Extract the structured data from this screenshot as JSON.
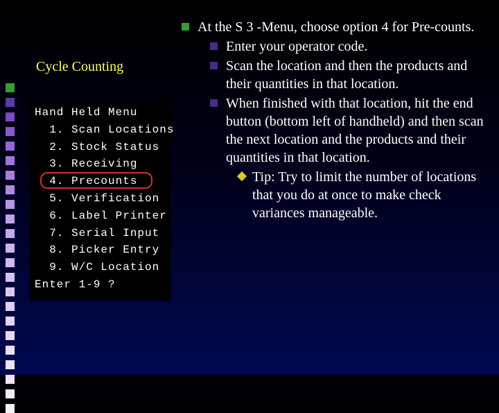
{
  "subtitle": "Cycle Counting",
  "decor": {
    "count": 23,
    "colors": [
      "#3a9a3a",
      "#5a3aa8",
      "#7a4ac0",
      "#8a5acc",
      "#9666d4",
      "#a072da",
      "#a87ede",
      "#b08ae2",
      "#b894e6",
      "#c0a0ea",
      "#c6a8ec",
      "#ccb2ee",
      "#d2baf0",
      "#d8c2f2",
      "#dcc8f4",
      "#e0cef6",
      "#e4d4f7",
      "#e8d8f8",
      "#ecdef9",
      "#eee2fa",
      "#f0e6fb",
      "#f2eafc",
      "#f4eefd"
    ]
  },
  "terminal": {
    "title": "Hand Held Menu",
    "items": [
      "  1. Scan Locations",
      "  2. Stock Status",
      "  3. Receiving",
      "  4. Precounts",
      "  5. Verification",
      "  6. Label Printer",
      "  7. Serial Input",
      "  8. Picker Entry",
      "  9. W/C Location"
    ],
    "prompt": "Enter 1-9 ?",
    "highlight_index": 3
  },
  "content": {
    "l1": "At the S 3 -Menu, choose option 4 for Pre-counts.",
    "l2": [
      "Enter your operator code.",
      "Scan the location and then the products and their quantities in that location.",
      "When finished with that location, hit the end button (bottom left of handheld) and then scan the next location and the products and their quantities in that location."
    ],
    "l3": "Tip:  Try to limit the number of locations that you do at once to make check variances manageable."
  }
}
